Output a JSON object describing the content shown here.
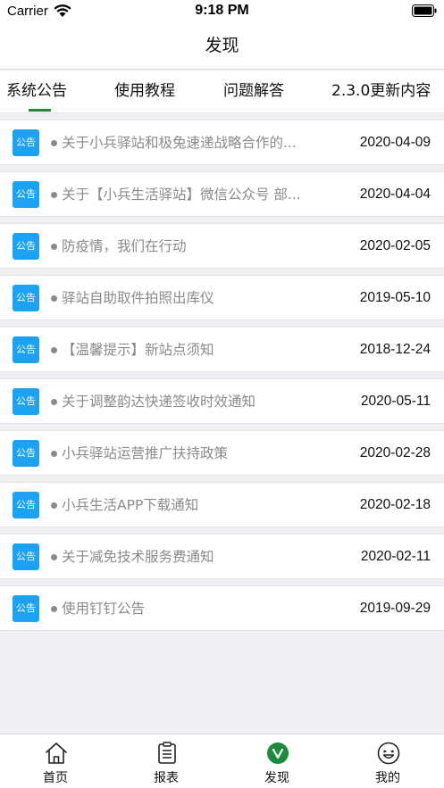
{
  "status": {
    "carrier": "Carrier",
    "time": "9:18 PM"
  },
  "nav": {
    "title": "发现"
  },
  "tabs": [
    {
      "label": "系统公告"
    },
    {
      "label": "使用教程"
    },
    {
      "label": "问题解答"
    },
    {
      "label": "2.3.0更新内容"
    }
  ],
  "badge_label": "公告",
  "colors": {
    "accent": "#1e8a3c",
    "badge": "#1da1f2"
  },
  "notices": [
    {
      "title": "关于小兵驿站和极兔速递战略合作的...",
      "date": "2020-04-09"
    },
    {
      "title": "关于【小兵生活驿站】微信公众号 部...",
      "date": "2020-04-04"
    },
    {
      "title": "防疫情，我们在行动",
      "date": "2020-02-05"
    },
    {
      "title": "驿站自助取件拍照出库仪",
      "date": "2019-05-10"
    },
    {
      "title": "【温馨提示】新站点须知",
      "date": "2018-12-24"
    },
    {
      "title": "关于调整韵达快递签收时效通知",
      "date": "2020-05-11"
    },
    {
      "title": "小兵驿站运营推广扶持政策",
      "date": "2020-02-28"
    },
    {
      "title": "小兵生活APP下载通知",
      "date": "2020-02-18"
    },
    {
      "title": "关于减免技术服务费通知",
      "date": "2020-02-11"
    },
    {
      "title": "使用钉钉公告",
      "date": "2019-09-29"
    }
  ],
  "tabbar": [
    {
      "label": "首页",
      "icon": "home-icon"
    },
    {
      "label": "报表",
      "icon": "report-icon"
    },
    {
      "label": "发现",
      "icon": "discover-icon"
    },
    {
      "label": "我的",
      "icon": "smiley-icon"
    }
  ]
}
